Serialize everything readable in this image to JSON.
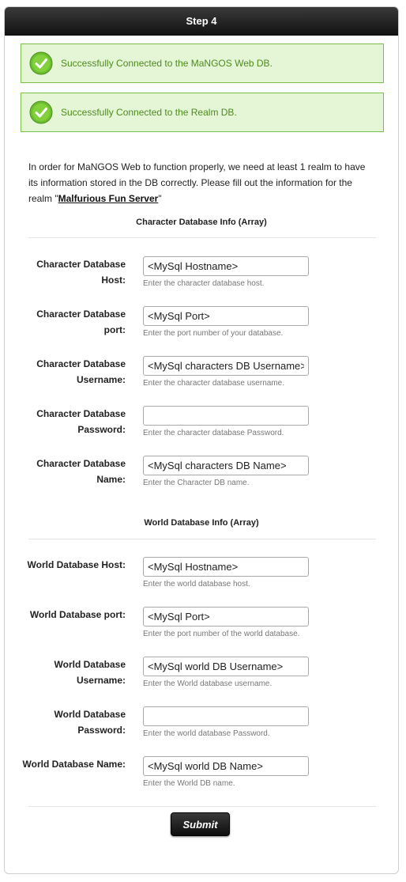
{
  "header": {
    "title": "Step 4"
  },
  "alerts": [
    {
      "icon": "check-circle-icon",
      "message": "Successfully Connected to the MaNGOS Web DB."
    },
    {
      "icon": "check-circle-icon",
      "message": "Successfully Connected to the Realm DB."
    }
  ],
  "intro": {
    "text_before": "In order for MaNGOS Web to function properly, we need at least 1 realm to have its information stored in the DB correctly. Please fill out the information for the realm \"",
    "realm_name": "Malfurious Fun Server",
    "text_after": "\""
  },
  "character_db": {
    "title": "Character Database Info (Array)",
    "fields": [
      {
        "label": "Character Database Host:",
        "value": "<MySql Hostname>",
        "hint": "Enter the character database host."
      },
      {
        "label": "Character Database port:",
        "value": "<MySql Port>",
        "hint": "Enter the port number of your database."
      },
      {
        "label": "Character Database Username:",
        "value": "<MySql characters DB Username>",
        "hint": "Enter the character database username."
      },
      {
        "label": "Character Database Password:",
        "value": "",
        "hint": "Enter the character database Password."
      },
      {
        "label": "Character Database Name:",
        "value": "<MySql characters DB Name>",
        "hint": "Enter the Character DB name."
      }
    ]
  },
  "world_db": {
    "title": "World Database Info (Array)",
    "fields": [
      {
        "label": "World Database Host:",
        "value": "<MySql Hostname>",
        "hint": "Enter the world database host."
      },
      {
        "label": "World Database port:",
        "value": "<MySql Port>",
        "hint": "Enter the port number of the world database."
      },
      {
        "label": "World Database Username:",
        "value": "<MySql world DB Username>",
        "hint": "Enter the World database username."
      },
      {
        "label": "World Database Password:",
        "value": "",
        "hint": "Enter the world database Password."
      },
      {
        "label": "World Database Name:",
        "value": "<MySql world DB Name>",
        "hint": "Enter the World DB name."
      }
    ]
  },
  "submit_label": "Submit",
  "colors": {
    "header_bg": "#1a1a1a",
    "success_bg": "#e4f6d6",
    "success_border": "#7cc043",
    "success_text": "#4f8a1e"
  }
}
